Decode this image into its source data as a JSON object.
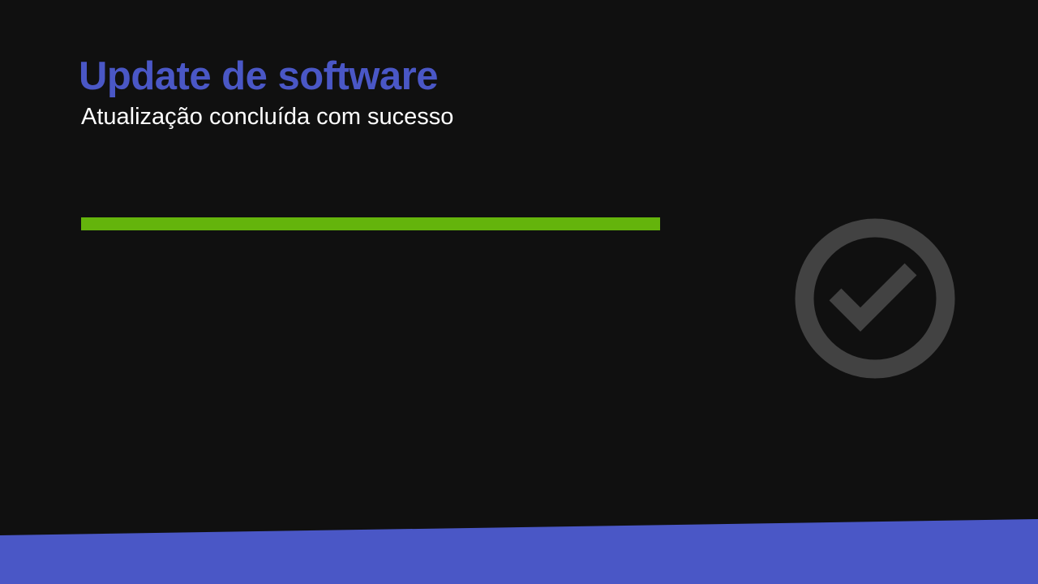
{
  "header": {
    "title": "Update de software",
    "subtitle": "Atualização concluída com sucesso"
  },
  "progress": {
    "fraction": 1.0
  },
  "status_icon": {
    "name": "check-circle-icon",
    "color": "#424242"
  },
  "theme": {
    "background": "#101010",
    "accent": "#4a57c6",
    "progress_color": "#64b40c",
    "text": "#ffffff"
  }
}
